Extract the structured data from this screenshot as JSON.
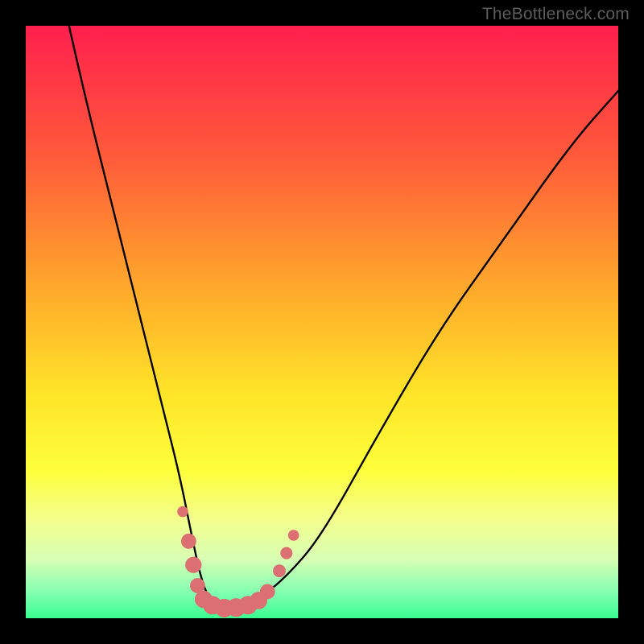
{
  "watermark": "TheBottleneck.com",
  "colors": {
    "frame": "#000000",
    "curve": "#000000",
    "marker_fill": "#db6f71",
    "marker_stroke": "#db6f71"
  },
  "chart_data": {
    "type": "line",
    "title": "",
    "xlabel": "",
    "ylabel": "",
    "xlim": [
      0,
      100
    ],
    "ylim": [
      0,
      100
    ],
    "gradient_stops": [
      {
        "offset": 0.0,
        "color": "#ff1f4e"
      },
      {
        "offset": 0.22,
        "color": "#ff5a3a"
      },
      {
        "offset": 0.45,
        "color": "#ffab2b"
      },
      {
        "offset": 0.62,
        "color": "#ffe428"
      },
      {
        "offset": 0.75,
        "color": "#fdff3a"
      },
      {
        "offset": 0.83,
        "color": "#f4ff8a"
      },
      {
        "offset": 0.9,
        "color": "#d8ffb4"
      },
      {
        "offset": 0.96,
        "color": "#7dffb0"
      },
      {
        "offset": 1.0,
        "color": "#3afc91"
      }
    ],
    "series": [
      {
        "name": "bottleneck-curve",
        "x": [
          7.3,
          10,
          15,
          20,
          23,
          26,
          28,
          29.5,
          31,
          33,
          36,
          39,
          44,
          50,
          60,
          70,
          80,
          92,
          100
        ],
        "y": [
          100,
          88,
          68,
          48,
          36,
          24,
          14,
          7,
          3,
          2,
          2,
          3,
          7,
          14,
          32,
          49,
          63,
          80,
          89
        ]
      }
    ],
    "markers": [
      {
        "x": 26.5,
        "y": 18,
        "r": 0.85
      },
      {
        "x": 27.5,
        "y": 13,
        "r": 1.2
      },
      {
        "x": 28.3,
        "y": 9,
        "r": 1.3
      },
      {
        "x": 29.0,
        "y": 5.5,
        "r": 1.2
      },
      {
        "x": 30.0,
        "y": 3.2,
        "r": 1.4
      },
      {
        "x": 31.5,
        "y": 2.2,
        "r": 1.5
      },
      {
        "x": 33.5,
        "y": 1.7,
        "r": 1.5
      },
      {
        "x": 35.5,
        "y": 1.8,
        "r": 1.5
      },
      {
        "x": 37.5,
        "y": 2.2,
        "r": 1.5
      },
      {
        "x": 39.3,
        "y": 3.0,
        "r": 1.4
      },
      {
        "x": 40.8,
        "y": 4.5,
        "r": 1.2
      },
      {
        "x": 42.8,
        "y": 8,
        "r": 1.0
      },
      {
        "x": 44.0,
        "y": 11,
        "r": 0.95
      },
      {
        "x": 45.2,
        "y": 14,
        "r": 0.85
      }
    ]
  }
}
